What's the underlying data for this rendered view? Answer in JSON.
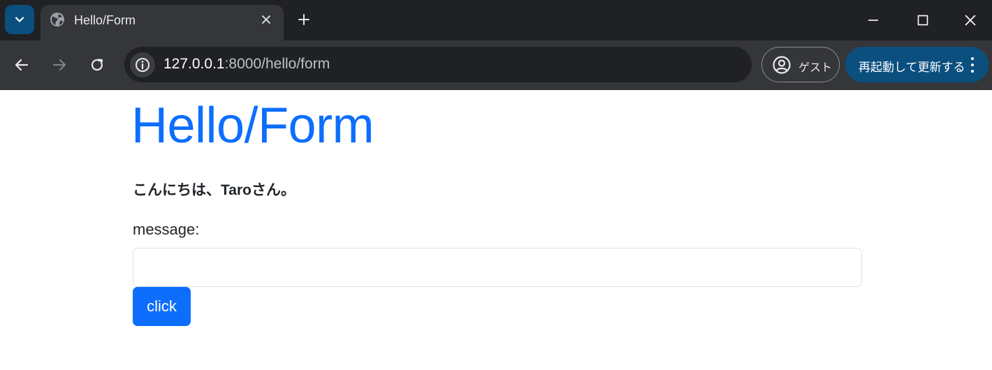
{
  "browser": {
    "tab": {
      "title": "Hello/Form",
      "favicon": "globe-icon"
    },
    "address_bar": {
      "host": "127.0.0.1",
      "path": ":8000/hello/form"
    },
    "profile": {
      "label": "ゲスト",
      "icon": "profile-icon"
    },
    "update_button": {
      "label": "再起動して更新する"
    },
    "colors": {
      "frame": "#202124",
      "toolbar": "#35363a",
      "accent": "#0b4f7f"
    }
  },
  "page": {
    "title": "Hello/Form",
    "greeting": "こんにちは、Taroさん。",
    "form": {
      "label": "message:",
      "input_value": "",
      "button_label": "click"
    },
    "colors": {
      "primary": "#0d6efd",
      "text": "#212529",
      "border": "#dee2e6"
    }
  }
}
